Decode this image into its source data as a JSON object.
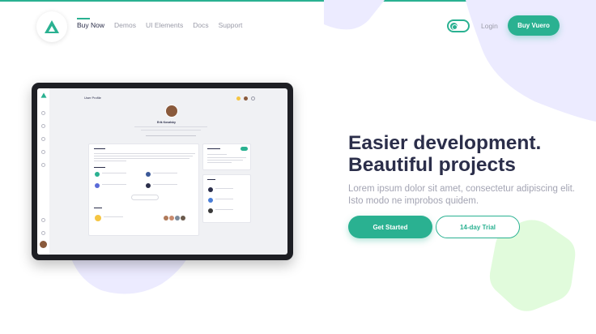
{
  "nav": {
    "items": [
      {
        "label": "Buy Now",
        "active": true
      },
      {
        "label": "Demos",
        "active": false
      },
      {
        "label": "UI Elements",
        "active": false
      },
      {
        "label": "Docs",
        "active": false
      },
      {
        "label": "Support",
        "active": false
      }
    ],
    "login_label": "Login",
    "buy_label": "Buy Vuero",
    "dark_mode_toggle_on": true
  },
  "hero": {
    "title_line1": "Easier development.",
    "title_line2": "Beautiful projects",
    "lead": "Lorem ipsum dolor sit amet, consectetur adipiscing elit. Isto modo ne improbos quidem.",
    "cta_primary": "Get Started",
    "cta_secondary": "14-day Trial"
  },
  "tablet": {
    "page_title": "User Profile",
    "user_name": "Erik Kovalsky"
  },
  "colors": {
    "primary": "#2ab191",
    "heading": "#2b2e4a",
    "muted": "#a3a4b3",
    "blob_purple": "#ecebff",
    "blob_green": "#e1fbdc"
  }
}
